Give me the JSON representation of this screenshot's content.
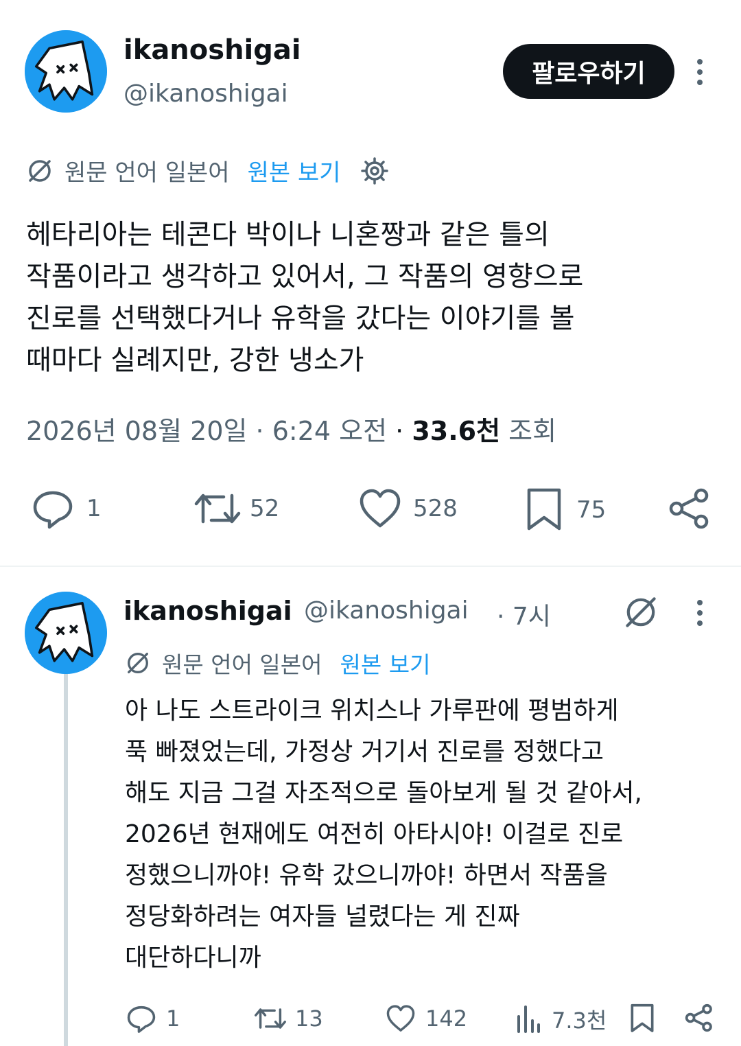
{
  "post": {
    "author_name": "ikanoshigai",
    "author_handle": "@ikanoshigai",
    "follow_label": "팔로우하기",
    "translation": {
      "source_label": "원문 언어 일본어",
      "show_original": "원본 보기"
    },
    "text_lines": [
      "헤타리아는 테콘다 박이나 니혼짱과 같은 틀의",
      "작품이라고 생각하고 있어서, 그 작품의 영향으로",
      "진로를 선택했다거나 유학을 갔다는 이야기를 볼",
      "때마다 실례지만, 강한 냉소가"
    ],
    "date": "2026년 08월 20일",
    "sep1": "·",
    "time": "6:24 오전",
    "sep2": "·",
    "views": "33.6천",
    "views_label": "조회",
    "stats": {
      "replies": "1",
      "reposts": "52",
      "likes": "528",
      "bookmarks": "75"
    }
  },
  "reply": {
    "author_name": "ikanoshigai",
    "author_handle": "@ikanoshigai",
    "time_ago": "· 7시",
    "translation": {
      "source_label": "원문 언어 일본어",
      "show_original": "원본 보기"
    },
    "text_lines": [
      "아 나도 스트라이크 위치스나 가루판에 평범하게",
      "푹 빠졌었는데, 가정상 거기서 진로를 정했다고",
      "해도 지금 그걸 자조적으로 돌아보게 될 것 같아서,",
      "2026년 현재에도 여전히 아타시야! 이걸로 진로",
      "정했으니까야! 유학 갔으니까야! 하면서 작품을",
      "정당화하려는 여자들 널렸다는 게 진짜",
      "대단하다니까"
    ],
    "stats": {
      "replies": "1",
      "reposts": "13",
      "likes": "142",
      "views": "7.3천"
    }
  },
  "colors": {
    "accent": "#1d9bf0",
    "text": "#0f1419",
    "muted": "#536471",
    "button": "#0f1419"
  }
}
